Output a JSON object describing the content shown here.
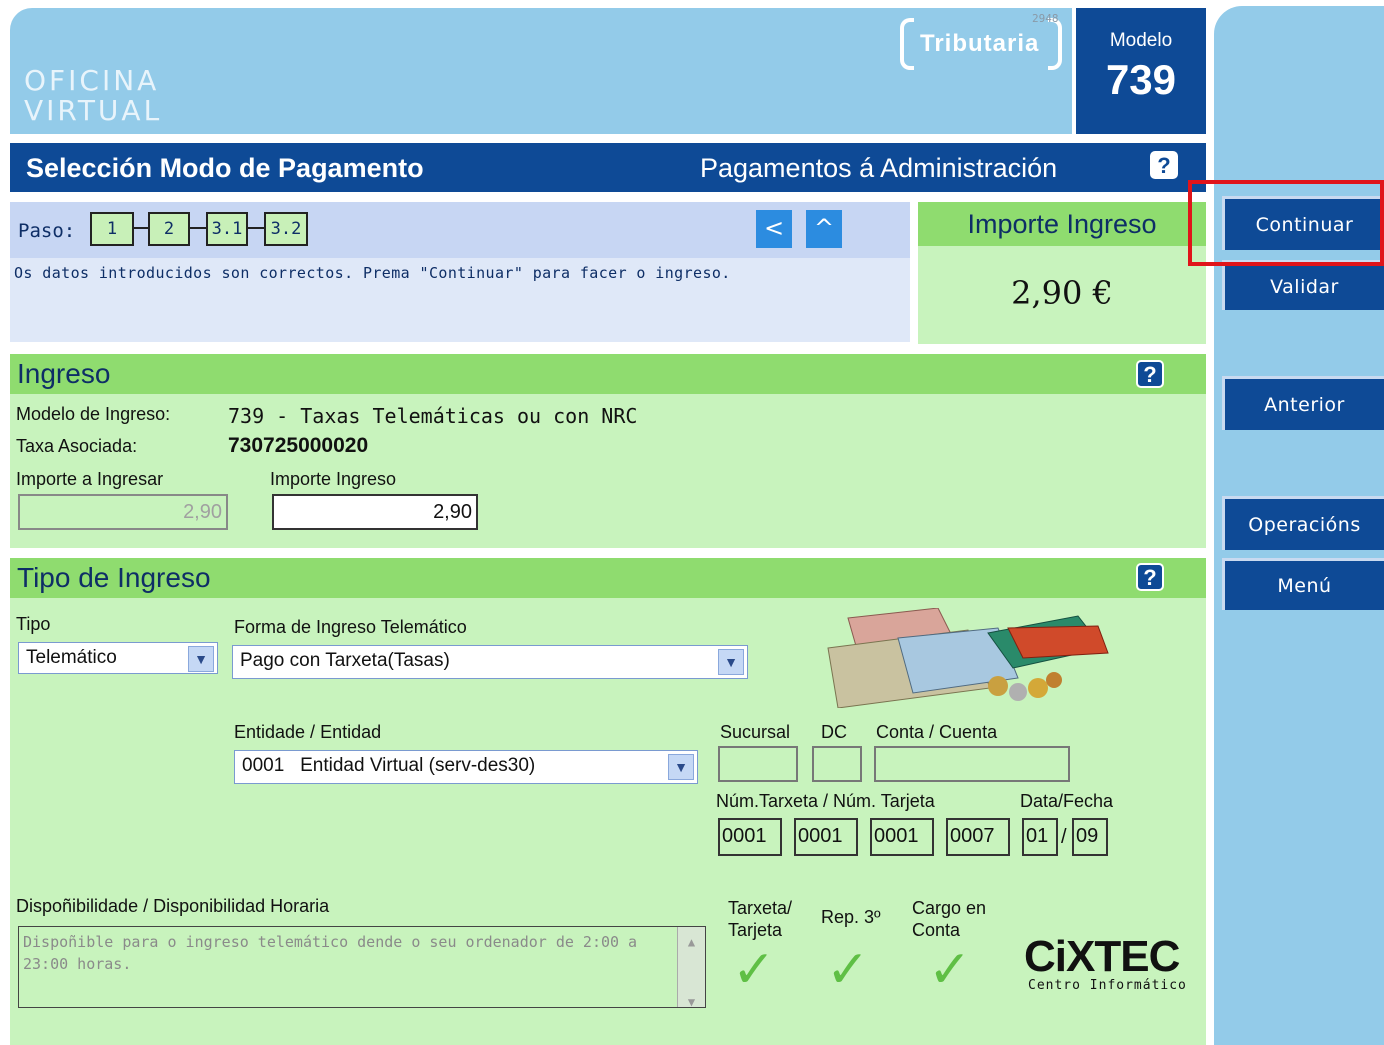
{
  "header": {
    "logo_line1": "OFICINA",
    "logo_line2": "VIRTUAL",
    "tributaria_text": "Tributaria",
    "tributaria_number": "2948",
    "modelo_label": "Modelo",
    "modelo_number": "739"
  },
  "titlebar": {
    "left_title": "Selección Modo de Pagamento",
    "right_title": "Pagamentos á Administración",
    "help": "?"
  },
  "steps": {
    "label": "Paso:",
    "items": [
      "1",
      "2",
      "3.1",
      "3.2"
    ],
    "back_icon": "<",
    "up_icon": "^",
    "message": "Os datos introducidos son correctos. Prema \"Continuar\" para facer o ingreso."
  },
  "importe_panel": {
    "header": "Importe Ingreso",
    "value": "2,90 €"
  },
  "ingreso": {
    "header": "Ingreso",
    "help": "?",
    "modelo_label": "Modelo de Ingreso:",
    "modelo_value": "739 - Taxas Telemáticas ou con NRC",
    "taxa_label": "Taxa Asociada:",
    "taxa_value": "730725000020",
    "importe_ingresar_label": "Importe a Ingresar",
    "importe_ingresar_value": "2,90",
    "importe_ingreso_label": "Importe Ingreso",
    "importe_ingreso_value": "2,90"
  },
  "tipo_ingreso": {
    "header": "Tipo de Ingreso",
    "help": "?",
    "tipo_label": "Tipo",
    "tipo_value": "Telemático",
    "forma_label": "Forma de Ingreso Telemático",
    "forma_value": "Pago con Tarxeta(Tasas)",
    "entidade_label": "Entidade / Entidad",
    "entidade_value": "0001   Entidad Virtual (serv-des30)",
    "sucursal_label": "Sucursal",
    "dc_label": "DC",
    "conta_label": "Conta / Cuenta",
    "tarxeta_label": "Núm.Tarxeta / Núm. Tarjeta",
    "tarxeta_values": [
      "0001",
      "0001",
      "0001",
      "0007"
    ],
    "data_label": "Data/Fecha",
    "data_month": "01",
    "data_sep": "/",
    "data_year": "09",
    "disp_label": "Dispoñibilidade / Disponibilidad Horaria",
    "disp_text": "Dispoñible para o ingreso telemático dende o seu ordenador de 2:00 a 23:00 horas.",
    "check1_label": "Tarxeta/\nTarjeta",
    "check2_label": "Rep. 3º",
    "check3_label": "Cargo en\nConta",
    "check_glyph": "✓"
  },
  "sidebar": {
    "continuar": "Continuar",
    "validar": "Validar",
    "anterior": "Anterior",
    "operacions": "Operacións",
    "menu": "Menú"
  },
  "footer_logo": {
    "text": "CiXTEC",
    "sub": "Centro Informático"
  },
  "colors": {
    "dark_blue": "#0e4a96",
    "light_blue": "#93cbe9",
    "green_header": "#8fdc6f",
    "green_body": "#c8f3bd",
    "highlight_red": "#e0141a"
  }
}
